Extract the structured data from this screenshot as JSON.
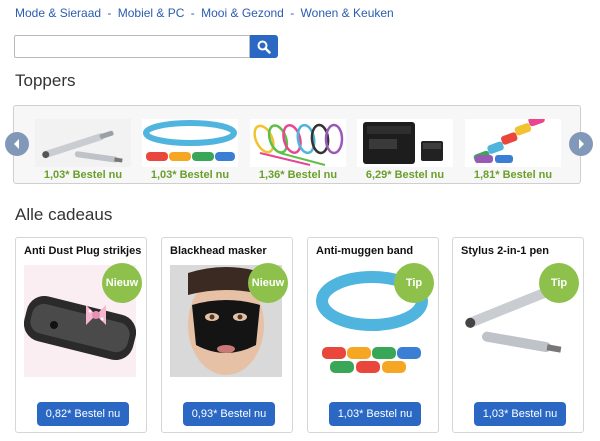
{
  "nav": {
    "links": [
      "Mode & Sieraad",
      "Mobiel & PC",
      "Mooi & Gezond",
      "Wonen & Keuken"
    ],
    "separator": "-"
  },
  "search": {
    "placeholder": "",
    "value": "",
    "icon": "search-icon"
  },
  "toppers": {
    "title": "Toppers",
    "items": [
      {
        "price_label": "1,03* Bestel nu",
        "image": "stylus-pen"
      },
      {
        "price_label": "1,03* Bestel nu",
        "image": "anti-mosquito-band"
      },
      {
        "price_label": "1,36* Bestel nu",
        "image": "cable-clips"
      },
      {
        "price_label": "6,29* Bestel nu",
        "image": "micro-sd-card"
      },
      {
        "price_label": "1,81* Bestel nu",
        "image": "usb-car-chargers"
      }
    ]
  },
  "all_gifts": {
    "title": "Alle cadeaus",
    "cards": [
      {
        "title": "Anti Dust Plug strikjes",
        "badge": "Nieuw",
        "button": "0,82* Bestel nu",
        "image": "phone-bow-plug"
      },
      {
        "title": "Blackhead masker",
        "badge": "Nieuw",
        "button": "0,93* Bestel nu",
        "image": "face-mask"
      },
      {
        "title": "Anti-muggen band",
        "badge": "Tip",
        "button": "1,03* Bestel nu",
        "image": "anti-mosquito-band"
      },
      {
        "title": "Stylus 2-in-1 pen",
        "badge": "Tip",
        "button": "1,03* Bestel nu",
        "image": "stylus-pen"
      }
    ]
  },
  "colors": {
    "accent_blue": "#2b68c4",
    "badge_green": "#8ec14b",
    "price_green": "#6a9f2b",
    "link_blue": "#2a5db0"
  }
}
